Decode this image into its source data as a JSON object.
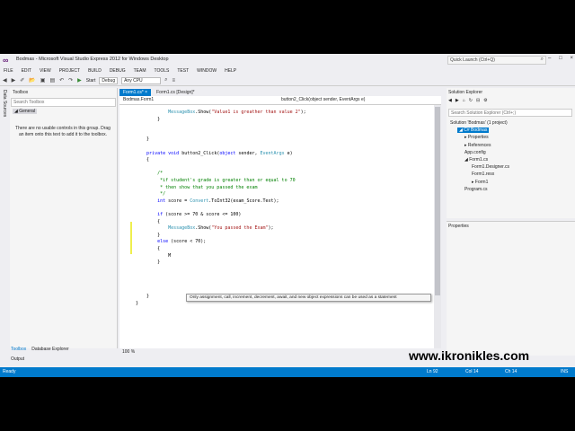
{
  "window": {
    "title": "Bodmas - Microsoft Visual Studio Express 2012 for Windows Desktop",
    "quick_launch_placeholder": "Quick Launch (Ctrl+Q)",
    "controls": [
      "–",
      "□",
      "×"
    ]
  },
  "menu": [
    "FILE",
    "EDIT",
    "VIEW",
    "PROJECT",
    "BUILD",
    "DEBUG",
    "TEAM",
    "TOOLS",
    "TEST",
    "WINDOW",
    "HELP"
  ],
  "toolbar": {
    "start_label": "Start",
    "config": "Debug",
    "platform": "Any CPU"
  },
  "left_tab": "Data Sources",
  "toolbox": {
    "title": "Toolbox",
    "search_placeholder": "Search Toolbox",
    "group": "◢ General",
    "message": "There are no usable controls in this group. Drag an item onto this text to add it to the toolbox.",
    "bottom_tabs": [
      "Toolbox",
      "Database Explorer"
    ],
    "output_tab": "Output"
  },
  "doc_tabs": [
    {
      "label": "Form1.cs*  ×",
      "active": true
    },
    {
      "label": "Form1.cs [Design]*",
      "active": false
    }
  ],
  "navbar": {
    "class_selector": "Bodmas.Form1",
    "member_selector": "button2_Click(object sender, EventArgs e)"
  },
  "code": {
    "lines": [
      "            MessageBox.Show(\"Value1 is greather than value 2\");",
      "        }",
      "",
      "",
      "    }",
      "",
      "    private void button2_Click(object sender, EventArgs e)",
      "    {",
      "",
      "        /*",
      "         *if student's grade is greater than or equal to 70",
      "         * then show that you passed the exam",
      "         */",
      "        int score = Convert.ToInt32(exam_Score.Text);",
      "",
      "        if (score >= 70 & score <= 100)",
      "        {",
      "            MessageBox.Show(\"You passed the Exam\");",
      "        }",
      "        else (score < 70);",
      "        {",
      "            M",
      "        }",
      "",
      "",
      "",
      "",
      "    }",
      "}"
    ]
  },
  "intellisense": "Only assignment, call, increment, decrement, await, and new object expressions can be used as a statement",
  "zoom": "100 %",
  "solution_explorer": {
    "title": "Solution Explorer",
    "search_placeholder": "Search Solution Explorer (Ctrl+;)",
    "items": [
      {
        "label": "Solution 'Bodmas' (1 project)",
        "indent": 0,
        "selected": false
      },
      {
        "label": "◢ C# Bodmas",
        "indent": 1,
        "selected": true
      },
      {
        "label": "▸ Properties",
        "indent": 2,
        "selected": false
      },
      {
        "label": "▸ References",
        "indent": 2,
        "selected": false
      },
      {
        "label": "App.config",
        "indent": 2,
        "selected": false
      },
      {
        "label": "◢ Form1.cs",
        "indent": 2,
        "selected": false
      },
      {
        "label": "Form1.Designer.cs",
        "indent": 3,
        "selected": false
      },
      {
        "label": "Form1.resx",
        "indent": 3,
        "selected": false
      },
      {
        "label": "▸ Form1",
        "indent": 3,
        "selected": false
      },
      {
        "label": "Program.cs",
        "indent": 2,
        "selected": false
      }
    ]
  },
  "properties": {
    "title": "Properties"
  },
  "status": {
    "text": "Ready",
    "line": "Ln 92",
    "col": "Col 14",
    "ch": "Ch 14",
    "mode": "INS"
  },
  "watermark": "www.ikronikles.com"
}
